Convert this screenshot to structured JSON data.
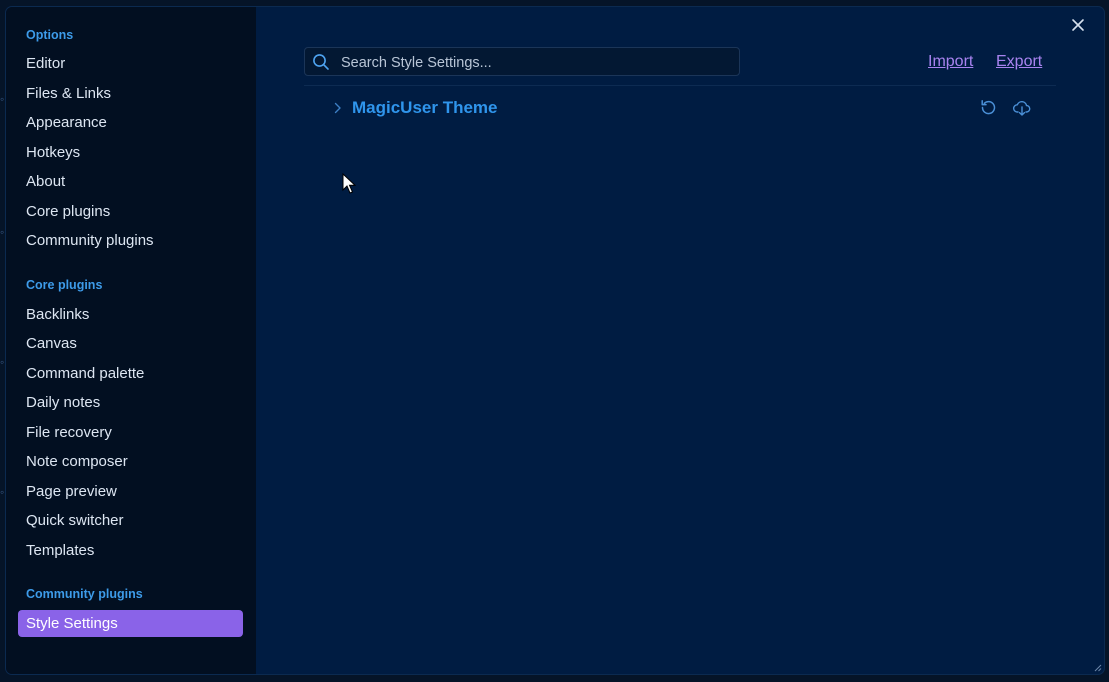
{
  "sidebar": {
    "sections": [
      {
        "title": "Options",
        "items": [
          "Editor",
          "Files & Links",
          "Appearance",
          "Hotkeys",
          "About",
          "Core plugins",
          "Community plugins"
        ]
      },
      {
        "title": "Core plugins",
        "items": [
          "Backlinks",
          "Canvas",
          "Command palette",
          "Daily notes",
          "File recovery",
          "Note composer",
          "Page preview",
          "Quick switcher",
          "Templates"
        ]
      },
      {
        "title": "Community plugins",
        "items": [
          "Style Settings"
        ]
      }
    ],
    "active_item": "Style Settings"
  },
  "content": {
    "search": {
      "placeholder": "Search Style Settings...",
      "value": ""
    },
    "import_label": "Import",
    "export_label": "Export",
    "theme_section": {
      "title": "MagicUser Theme",
      "collapsed": true,
      "icons": [
        "reset-icon",
        "download-icon"
      ]
    }
  },
  "colors": {
    "accent": "#8a63e8",
    "heading_blue": "#2f95ec",
    "section_blue": "#3d9be9",
    "link_purple": "#a883f0",
    "modal_bg": "#001c42",
    "sidebar_bg": "#020f21"
  }
}
